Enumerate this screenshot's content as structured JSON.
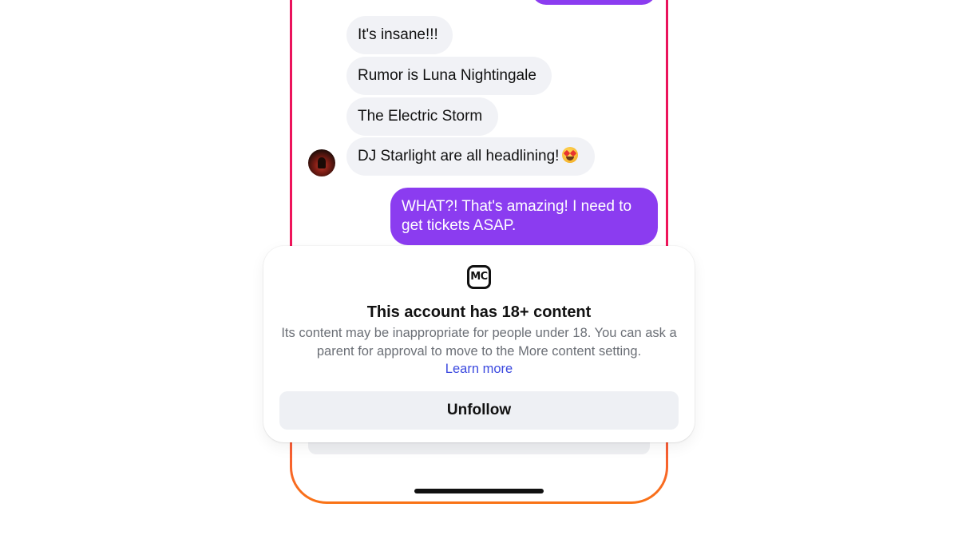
{
  "conversation": {
    "incoming_messages": [
      "It's insane!!!",
      "Rumor is Luna Nightingale",
      "The Electric Storm",
      "DJ Starlight are all headlining!"
    ],
    "emoji_icon": "star-struck-emoji",
    "outgoing_message": "WHAT?! That's amazing! I need to get tickets ASAP."
  },
  "modal": {
    "badge_text": "MC",
    "title": "This account has 18+ content",
    "body": "Its content may be inappropriate for people under 18. You can ask a parent for approval to move to the More content setting.",
    "link_label": "Learn more",
    "button_label": "Unfollow"
  },
  "colors": {
    "outgoing_bubble": "#8b3cf0",
    "incoming_bubble": "#f1f2f6",
    "link": "#3b49df",
    "phone_border_top": "#e8125c",
    "phone_border_bottom": "#f97316",
    "button_bg": "#eef0f4"
  }
}
